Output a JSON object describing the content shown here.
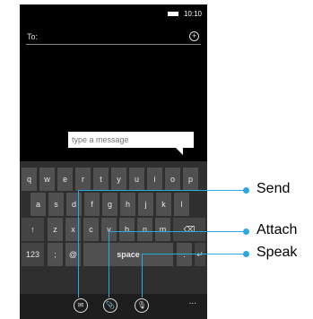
{
  "status": {
    "time": "10:10"
  },
  "compose": {
    "to_label": "To:",
    "message_placeholder": "type a message"
  },
  "keyboard": {
    "row1": [
      "q",
      "w",
      "e",
      "r",
      "t",
      "y",
      "u",
      "i",
      "o",
      "p"
    ],
    "row2": [
      "a",
      "s",
      "d",
      "f",
      "g",
      "h",
      "j",
      "k",
      "l"
    ],
    "row3": [
      "↑",
      "z",
      "x",
      "c",
      "v",
      "b",
      "n",
      "m",
      "⌫"
    ],
    "row4": [
      "123",
      ";",
      "@",
      "space",
      ".",
      "↵"
    ]
  },
  "appbar": {
    "more": "..."
  },
  "callouts": {
    "send": "Send",
    "attach": "Attach",
    "speak": "Speak"
  }
}
